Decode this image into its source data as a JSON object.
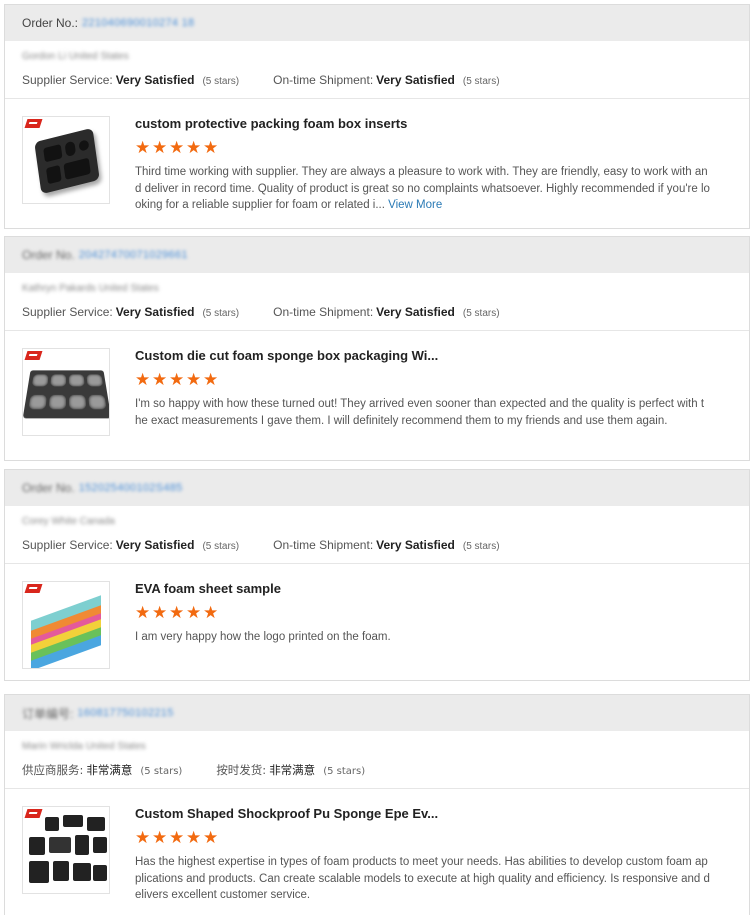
{
  "reviews": [
    {
      "order_label": "Order No.:",
      "order_number": "221040690010274 18",
      "buyer": "Gordon Li United States",
      "supplier_service_label": "Supplier Service:",
      "supplier_service_value": "Very Satisfied",
      "supplier_service_stars": "(5 stars)",
      "shipment_label": "On-time Shipment:",
      "shipment_value": "Very Satisfied",
      "shipment_stars": "(5 stars)",
      "product_title": "custom protective packing foam box inserts",
      "rating": 5,
      "text": "Third time working with supplier. They are always a pleasure to work with. They are friendly, easy to work with and deliver in record time. Quality of product is great so no complaints whatsoever. Highly recommended if you're looking for a reliable supplier for foam or related i...",
      "view_more": "View More"
    },
    {
      "order_label": "Order No.",
      "order_number": "20427470071029661",
      "buyer": "Kathryn Pakards United States",
      "supplier_service_label": "Supplier Service:",
      "supplier_service_value": "Very Satisfied",
      "supplier_service_stars": "(5 stars)",
      "shipment_label": "On-time Shipment:",
      "shipment_value": "Very Satisfied",
      "shipment_stars": "(5 stars)",
      "product_title": "Custom die cut foam sponge box packaging Wi...",
      "rating": 5,
      "text": "I'm so happy with how these turned out! They arrived even sooner than expected and the quality is perfect with the exact measurements I gave them. I will definitely recommend them to my friends and use them again.",
      "view_more": ""
    },
    {
      "order_label": "Order No.",
      "order_number": "152025400102S485",
      "buyer": "Corey White Canada",
      "supplier_service_label": "Supplier Service:",
      "supplier_service_value": "Very Satisfied",
      "supplier_service_stars": "(5 stars)",
      "shipment_label": "On-time Shipment:",
      "shipment_value": "Very Satisfied",
      "shipment_stars": "(5 stars)",
      "product_title": "EVA foam sheet sample",
      "rating": 5,
      "text": "I am very happy how the logo printed on the foam.",
      "view_more": ""
    },
    {
      "order_label": "订单编号:",
      "order_number": "160817750102215",
      "buyer": "Marin Wriclda United States",
      "supplier_service_label": "供应商服务:",
      "supplier_service_value": "非常满意",
      "supplier_service_stars": "(5 stars)",
      "shipment_label": "按时发货:",
      "shipment_value": "非常满意",
      "shipment_stars": "(5 stars)",
      "product_title": "Custom Shaped Shockproof Pu Sponge Epe Ev...",
      "rating": 5,
      "text": "Has the highest expertise in types of foam products to meet your needs.  Has abilities to develop custom foam applications and products.  Can create scalable models to execute at high quality and efficiency.  Is responsive and delivers excellent customer service.",
      "view_more": ""
    }
  ],
  "colors": {
    "star": "#f26a10",
    "link": "#2a7ab5",
    "order_bar": "#ebebeb"
  },
  "star_icon": "star-icon"
}
